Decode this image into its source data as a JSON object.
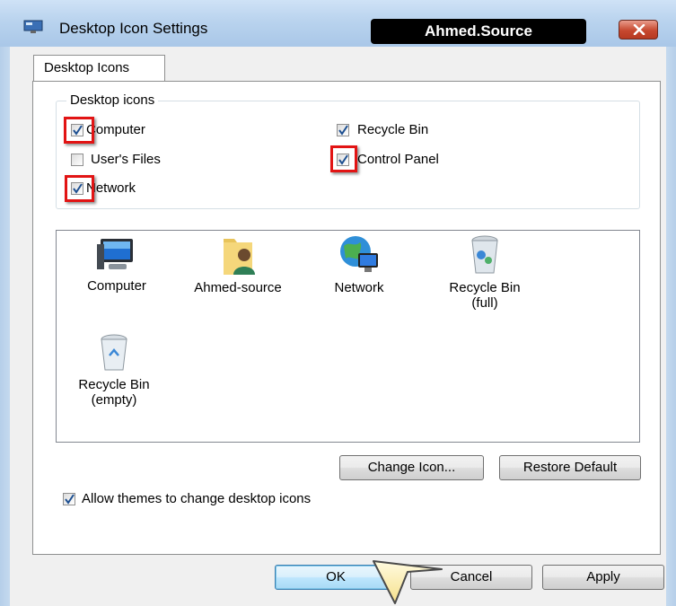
{
  "window": {
    "title": "Desktop Icon Settings",
    "watermark": "Ahmed.Source"
  },
  "tab": {
    "label": "Desktop Icons"
  },
  "group": {
    "title": "Desktop icons",
    "checkboxes": [
      {
        "label": "Computer",
        "checked": true
      },
      {
        "label": "Recycle Bin",
        "checked": true
      },
      {
        "label": "User's Files",
        "checked": false
      },
      {
        "label": "Control Panel",
        "checked": true
      },
      {
        "label": "Network",
        "checked": true
      }
    ]
  },
  "icons": [
    {
      "label": "Computer",
      "icon": "computer-icon"
    },
    {
      "label": "Ahmed-source",
      "icon": "user-folder-icon"
    },
    {
      "label": "Network",
      "icon": "network-globe-icon"
    },
    {
      "label_line1": "Recycle Bin",
      "label_line2": "(full)",
      "icon": "recycle-bin-full-icon"
    },
    {
      "label_line1": "Recycle Bin",
      "label_line2": "(empty)",
      "icon": "recycle-bin-empty-icon"
    }
  ],
  "buttons": {
    "change_icon": "Change Icon...",
    "restore_default": "Restore Default",
    "ok": "OK",
    "cancel": "Cancel",
    "apply": "Apply"
  },
  "allow_themes": {
    "label": "Allow themes to change desktop icons",
    "checked": true
  },
  "colors": {
    "highlight": "#e21414",
    "titlebar": "#b9d3ee"
  }
}
